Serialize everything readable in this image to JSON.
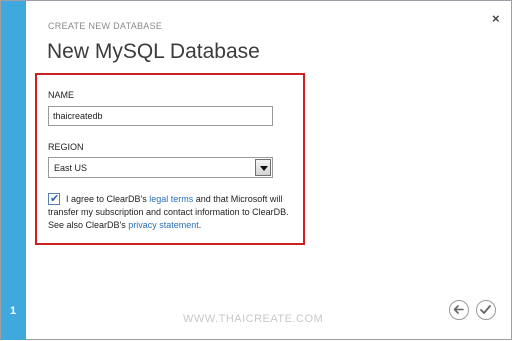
{
  "dialog": {
    "subtitle": "CREATE NEW DATABASE",
    "title": "New MySQL Database",
    "step_number": "1",
    "close_symbol": "×"
  },
  "form": {
    "name_label": "NAME",
    "name_value": "thaicreatedb",
    "region_label": "REGION",
    "region_value": "East US",
    "agree_checked": true,
    "agree_text_1": "I agree to ClearDB's ",
    "legal_terms_link": "legal terms",
    "agree_text_2": " and that Microsoft will transfer my subscription and contact information to ClearDB. See also ClearDB's ",
    "privacy_link": "privacy statement",
    "agree_text_3": "."
  },
  "watermark": "WWW.THAICREATE.COM",
  "colors": {
    "step_bar": "#3fa9dd",
    "highlight_border": "#cc1f1f",
    "link": "#2a6fb8"
  },
  "icons": {
    "close": "close-icon",
    "back": "back-arrow-icon",
    "finish": "checkmark-icon",
    "dropdown": "chevron-down-icon",
    "checkbox": "check-icon"
  }
}
